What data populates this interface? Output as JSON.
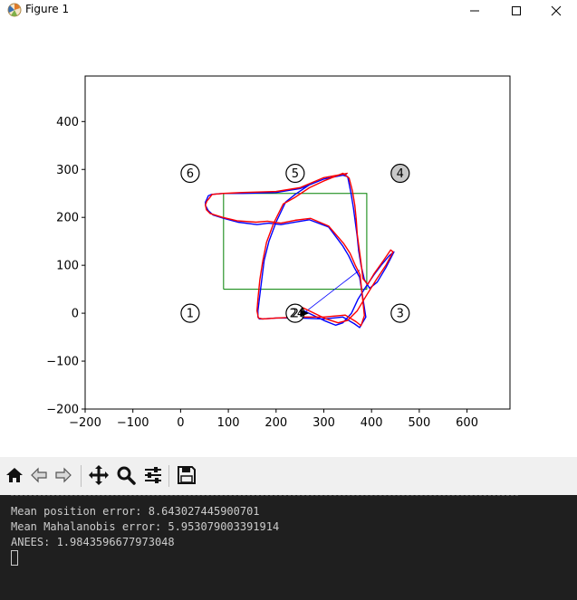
{
  "window": {
    "title": "Figure 1",
    "icons": [
      "matplotlib-app-icon",
      "minimize-icon",
      "maximize-icon",
      "close-icon"
    ]
  },
  "toolbar": {
    "icons": [
      "home-icon",
      "back-icon",
      "forward-icon",
      "pan-icon",
      "zoom-icon",
      "configure-subplots-icon",
      "save-icon"
    ]
  },
  "terminal": {
    "lines": [
      "Mean position error: 8.643027445900701",
      "Mean Mahalanobis error: 5.953079003391914",
      "ANEES: 1.9843596677973048"
    ]
  },
  "chart_data": {
    "type": "line",
    "title": "",
    "xlabel": "",
    "ylabel": "",
    "xlim": [
      -200,
      690
    ],
    "ylim": [
      -200,
      495
    ],
    "x_ticks": [
      -200,
      -100,
      0,
      100,
      200,
      300,
      400,
      500,
      600
    ],
    "y_ticks": [
      -200,
      -100,
      0,
      100,
      200,
      300,
      400
    ],
    "x_tick_labels": [
      "−200",
      "−100",
      "0",
      "100",
      "200",
      "300",
      "400",
      "500",
      "600"
    ],
    "y_tick_labels": [
      "−200",
      "−100",
      "0",
      "100",
      "200",
      "300",
      "400"
    ],
    "grid": false,
    "legend": "none",
    "colors": {
      "estimate": "#0000ff",
      "ground_truth": "#ff0000",
      "rectangle": "#008000",
      "landmark_fill_observed": "#c8c8c8"
    },
    "landmarks": [
      {
        "label": "1",
        "x": 20,
        "y": 0,
        "highlighted": false
      },
      {
        "label": "2",
        "x": 240,
        "y": 0,
        "highlighted": false
      },
      {
        "label": "3",
        "x": 460,
        "y": 0,
        "highlighted": false
      },
      {
        "label": "4",
        "x": 460,
        "y": 292,
        "highlighted": true
      },
      {
        "label": "5",
        "x": 240,
        "y": 292,
        "highlighted": false
      },
      {
        "label": "6",
        "x": 20,
        "y": 292,
        "highlighted": false
      }
    ],
    "rectangle": {
      "x": [
        90,
        390,
        390,
        90,
        90
      ],
      "y": [
        50,
        50,
        250,
        250,
        50
      ]
    },
    "robot_marker": {
      "x": 258,
      "y": 0,
      "label": "24"
    },
    "sensor_line": {
      "x": [
        258,
        375
      ],
      "y": [
        0,
        90
      ]
    },
    "series": [
      {
        "key": "estimate",
        "x": [
          252,
          300,
          325,
          340,
          358,
          372,
          388,
          405,
          420,
          437,
          447,
          430,
          412,
          396,
          385,
          378,
          373,
          370,
          366,
          362,
          357,
          350,
          340,
          300,
          270,
          240,
          220,
          200,
          185,
          175,
          170,
          165,
          162,
          162,
          165,
          172,
          200,
          250,
          300,
          340,
          364,
          375,
          388,
          375,
          364,
          352,
          340,
          310,
          270,
          240,
          210,
          185,
          160,
          120,
          90,
          68,
          58,
          52,
          52,
          55,
          58,
          65,
          90,
          130,
          200,
          250,
          300,
          348
        ],
        "y": [
          8,
          -15,
          -25,
          -20,
          0,
          30,
          55,
          80,
          100,
          120,
          128,
          95,
          65,
          52,
          70,
          100,
          130,
          160,
          190,
          220,
          250,
          285,
          288,
          280,
          268,
          248,
          232,
          190,
          150,
          110,
          70,
          30,
          5,
          -8,
          -12,
          -12,
          -10,
          -10,
          -12,
          -8,
          -22,
          -30,
          -8,
          75,
          95,
          120,
          140,
          180,
          195,
          190,
          185,
          188,
          185,
          190,
          198,
          205,
          214,
          225,
          232,
          238,
          245,
          248,
          250,
          250,
          252,
          260,
          280,
          290
        ]
      },
      {
        "key": "ground_truth",
        "x": [
          255,
          305,
          330,
          350,
          370,
          388,
          410,
          430,
          445,
          440,
          425,
          405,
          392,
          382,
          378,
          374,
          370,
          368,
          365,
          360,
          353,
          340,
          300,
          270,
          240,
          215,
          195,
          180,
          172,
          166,
          162,
          160,
          163,
          172,
          200,
          250,
          300,
          345,
          368,
          378,
          385,
          376,
          366,
          355,
          342,
          310,
          272,
          240,
          210,
          182,
          158,
          118,
          88,
          62,
          54,
          52,
          55,
          60,
          66,
          90,
          130,
          200,
          250,
          300,
          350
        ],
        "y": [
          12,
          -12,
          -20,
          -15,
          5,
          35,
          70,
          100,
          128,
          132,
          110,
          82,
          60,
          72,
          105,
          135,
          165,
          195,
          225,
          255,
          282,
          292,
          276,
          262,
          242,
          228,
          188,
          148,
          108,
          70,
          30,
          5,
          -10,
          -12,
          -10,
          -8,
          -8,
          -4,
          -18,
          -26,
          -5,
          80,
          100,
          125,
          145,
          182,
          198,
          194,
          188,
          192,
          190,
          193,
          200,
          208,
          216,
          226,
          234,
          240,
          248,
          250,
          252,
          254,
          262,
          283,
          292
        ]
      }
    ]
  }
}
